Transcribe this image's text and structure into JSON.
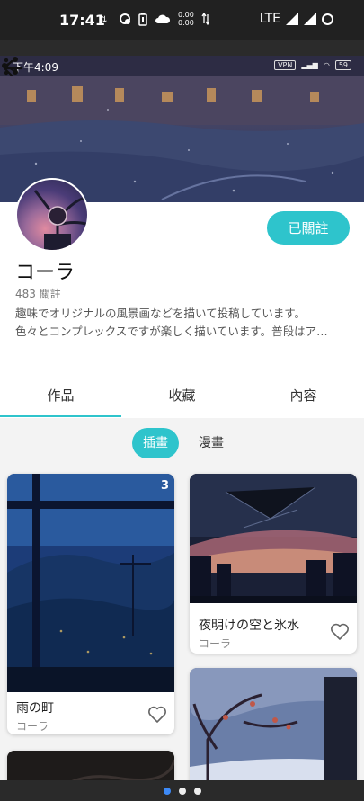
{
  "system_status": {
    "time": "17:41",
    "icons": [
      "bluetooth-speed-icon",
      "sync-icon",
      "battery-saver-icon",
      "cloud-icon"
    ],
    "net_speed_up": "0.00",
    "net_speed_down": "0.00",
    "network": "LTE"
  },
  "banner": {
    "inner_time": "下午4:09",
    "inner_vpn": "VPN",
    "inner_battery": "59"
  },
  "profile": {
    "name": "コーラ",
    "follow_count": "483 關註",
    "follow_button": "已關註",
    "bio_line1": "趣味でオリジナルの風景画などを描いて投稿しています。",
    "bio_line2": "色々とコンプレックスですが楽しく描いています。普段はア…"
  },
  "tabs": [
    "作品",
    "收藏",
    "內容"
  ],
  "chips": [
    "插畫",
    "漫畫"
  ],
  "works": [
    {
      "title": "雨の町",
      "author": "コーラ",
      "page_count": "3"
    },
    {
      "title": "夜明けの空と氷水",
      "author": "コーラ"
    }
  ],
  "pager": {
    "active_index": 0,
    "count": 3
  },
  "colors": {
    "accent": "#2ec4cc",
    "status_bar": "#212121"
  }
}
